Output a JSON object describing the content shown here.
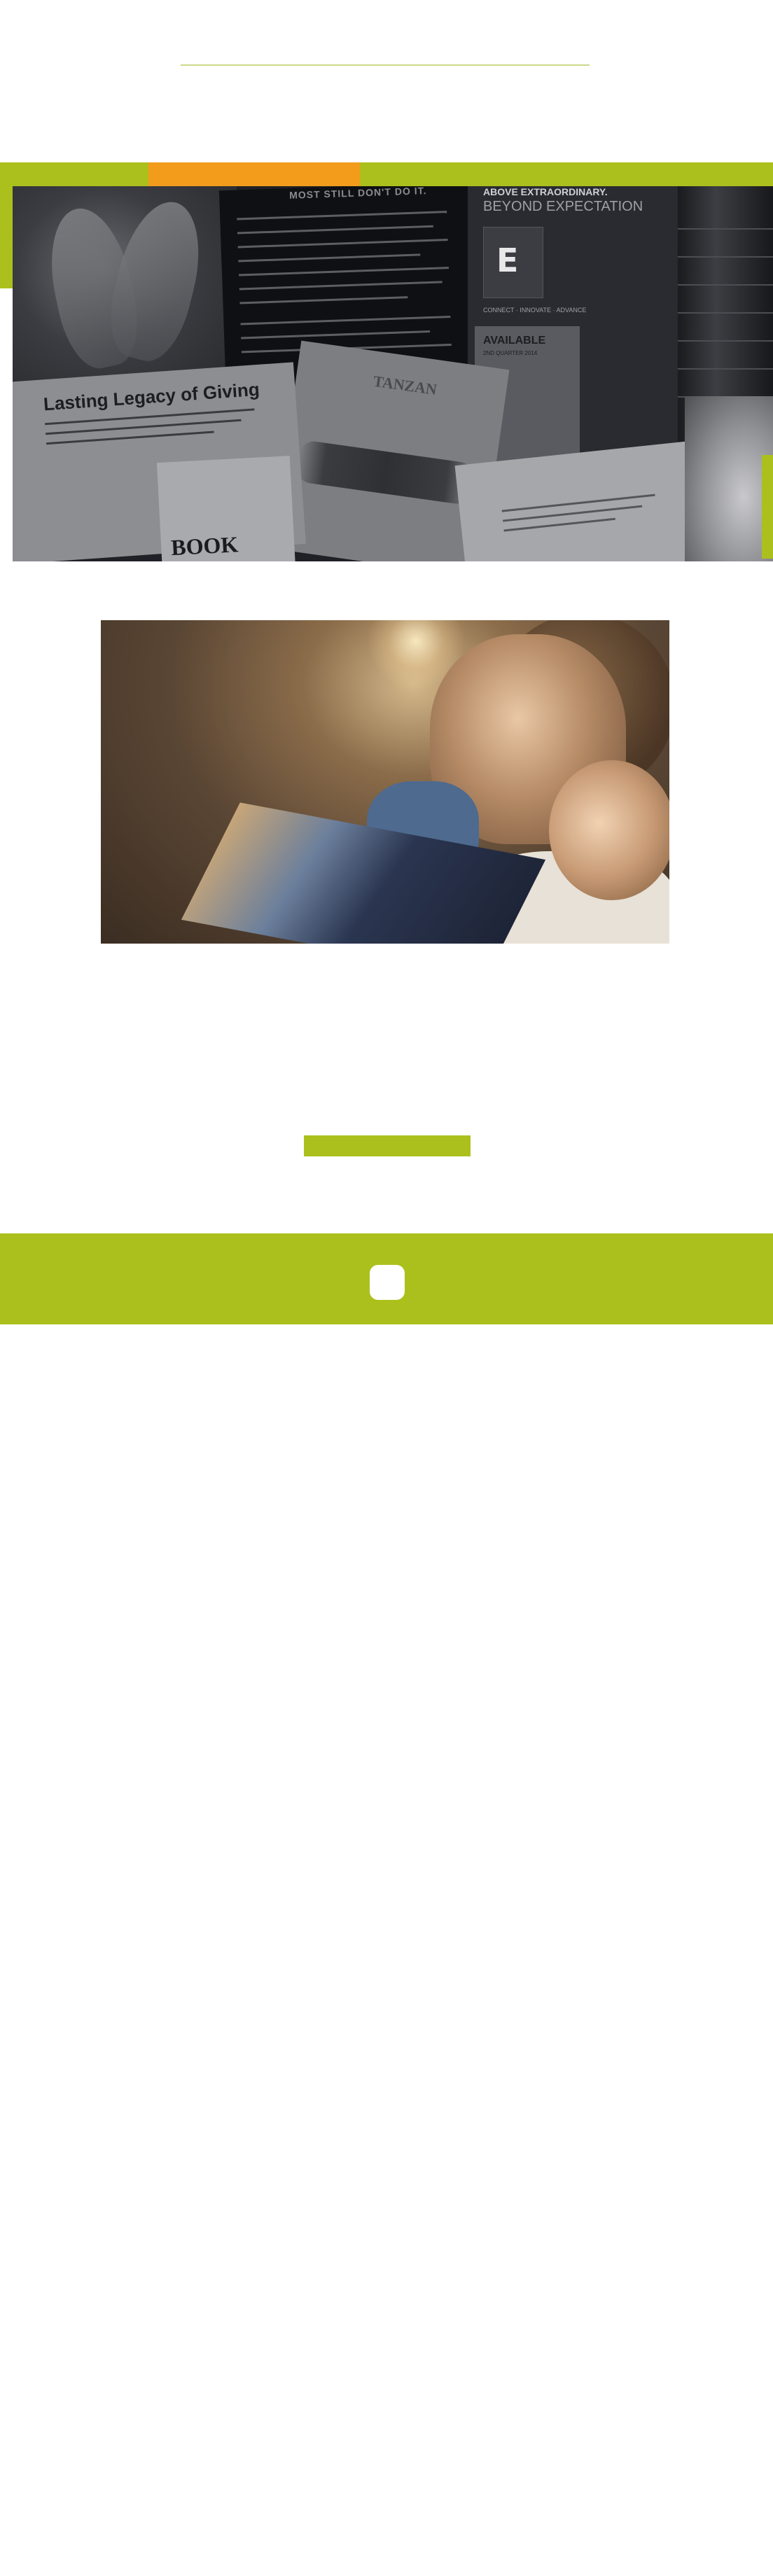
{
  "collage": {
    "doc_title": "MOST STILL DON'T DO IT.",
    "above": "ABOVE EXTRAORDINARY.",
    "beyond": "BEYOND EXPECTATION",
    "tagline": "CONNECT · INNOVATE · ADVANCE",
    "available": "AVAILABLE",
    "available_sub": "2ND QUARTER 2014",
    "giving_title": "Lasting Legacy of Giving",
    "book_title": "BOOK",
    "tan_title": "TANZAN"
  },
  "colors": {
    "accent_green": "#acc01d",
    "accent_orange": "#f39c1c"
  },
  "footer": {
    "icon": "square-icon"
  }
}
